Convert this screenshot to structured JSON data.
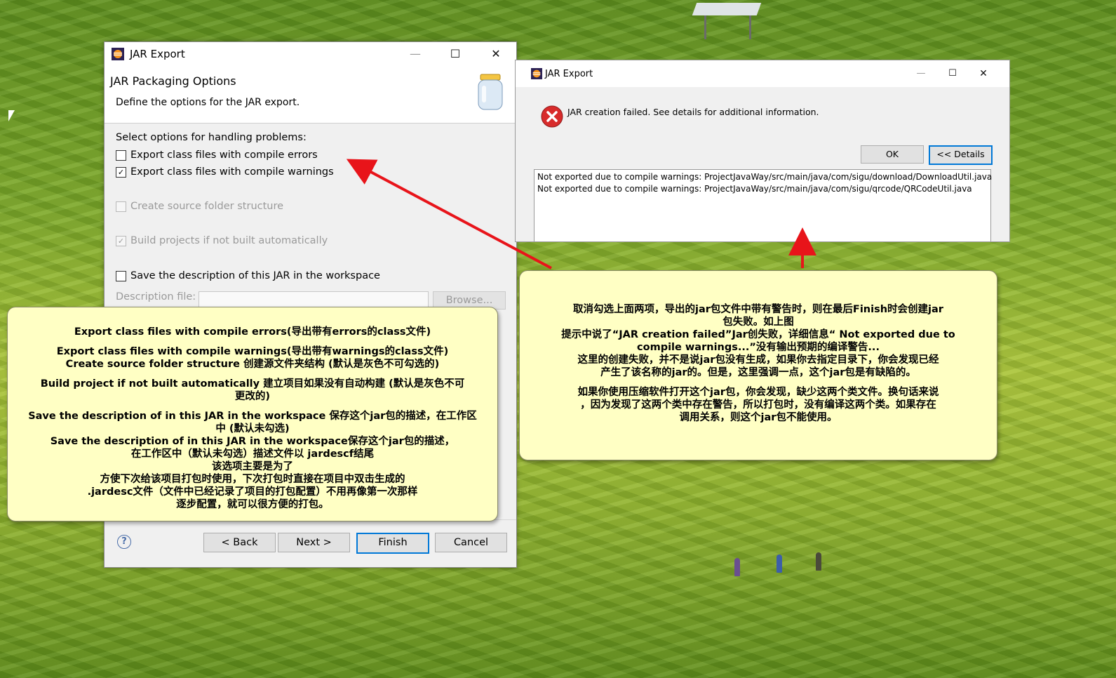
{
  "wizard": {
    "title": "JAR Export",
    "header_title": "JAR Packaging Options",
    "header_desc": "Define the options for the JAR export.",
    "section_label": "Select options for handling problems:",
    "options": {
      "compile_errors": {
        "label": "Export class files with compile errors",
        "checked": false,
        "enabled": true
      },
      "compile_warnings": {
        "label": "Export class files with compile warnings",
        "checked": true,
        "enabled": true
      },
      "source_folder": {
        "label": "Create source folder structure",
        "checked": false,
        "enabled": false
      },
      "build_projects": {
        "label": "Build projects if not built automatically",
        "checked": true,
        "enabled": false
      },
      "save_description": {
        "label": "Save the description of this JAR in the workspace",
        "checked": false,
        "enabled": true
      }
    },
    "description_label": "Description file:",
    "browse_label": "Browse...",
    "help_glyph": "?",
    "buttons": {
      "back": "< Back",
      "next": "Next >",
      "finish": "Finish",
      "cancel": "Cancel"
    }
  },
  "error_dialog": {
    "title": "JAR Export",
    "message": "JAR creation failed. See details for additional information.",
    "ok_label": "OK",
    "details_label": "<< Details",
    "details_lines": [
      "Not exported due to compile warnings: ProjectJavaWay/src/main/java/com/sigu/download/DownloadUtil.java",
      "Not exported due to compile warnings: ProjectJavaWay/src/main/java/com/sigu/qrcode/QRCodeUtil.java"
    ]
  },
  "note_left": {
    "p1": "Export class files with compile errors(导出带有errors的class文件)",
    "p2a": "Export class files with compile warnings(导出带有warnings的class文件)",
    "p2b": "Create source folder structure 创建源文件夹结构 (默认是灰色不可勾选的)",
    "p3a": "Build project if not built automatically 建立项目如果没有自动构建 (默认是灰色不可",
    "p3b": "更改的)",
    "p4a": "Save the description of in this JAR in the workspace 保存这个jar包的描述，在工作区",
    "p4b": "中 (默认未勾选)",
    "p5a": "Save the description of in this JAR in the workspace保存这个jar包的描述，",
    "p5b": "在工作区中（默认未勾选）描述文件以 jardescf结尾",
    "p5c": "该选项主要是为了",
    "p5d": "方使下次给该项目打包时使用，下次打包时直接在项目中双击生成的",
    "p5e": ".jardesc文件（文件中已经记录了项目的打包配置）不用再像第一次那样",
    "p5f": "逐步配置，就可以很方便的打包。"
  },
  "note_right": {
    "l1": "取消勾选上面两项，导出的jar包文件中带有警告时，则在最后Finish时会创建jar",
    "l2": "包失败。如上图",
    "l3": "提示中说了“JAR creation failed”Jar创失败，详细信息“ Not exported due to",
    "l4": "compile warnings...”没有输出预期的编译警告...",
    "l5": "这里的创建失败，并不是说jar包没有生成，如果你去指定目录下，你会发现已经",
    "l6": "产生了该名称的jar的。但是，这里强调一点，这个jar包是有缺陷的。",
    "l7": "如果你使用压缩软件打开这个jar包，你会发现，缺少这两个类文件。换句话来说",
    "l8": "，因为发现了这两个类中存在警告，所以打包时，没有编译这两个类。如果存在",
    "l9": "调用关系，则这个jar包不能使用。"
  },
  "colors": {
    "arrow": "#e8141a",
    "note_bg": "#ffffc4",
    "default_button_border": "#0078d7"
  }
}
